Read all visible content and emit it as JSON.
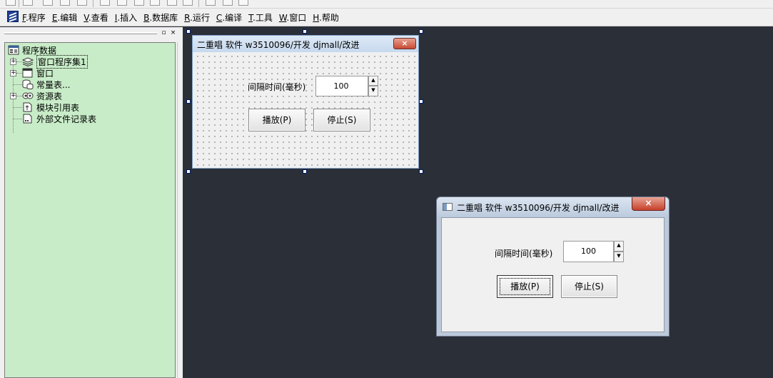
{
  "menu": {
    "items": [
      {
        "key": "F",
        "label": ".程序"
      },
      {
        "key": "E",
        "label": ".编辑"
      },
      {
        "key": "V",
        "label": ".查看"
      },
      {
        "key": "I",
        "label": ".插入"
      },
      {
        "key": "B",
        "label": ".数据库"
      },
      {
        "key": "R",
        "label": ".运行"
      },
      {
        "key": "C",
        "label": ".编译"
      },
      {
        "key": "T",
        "label": ".工具"
      },
      {
        "key": "W",
        "label": ".窗口"
      },
      {
        "key": "H",
        "label": ".帮助"
      }
    ]
  },
  "panel": {
    "pin_glyph": "▫",
    "close_glyph": "×",
    "tree": {
      "root": "程序数据",
      "items": [
        {
          "label": "窗口程序集1",
          "icon": "layers-icon",
          "expandable": true,
          "selected": true
        },
        {
          "label": "窗口",
          "icon": "window-icon",
          "expandable": true
        },
        {
          "label": "常量表...",
          "icon": "cylinder-icon",
          "expandable": false
        },
        {
          "label": "资源表",
          "icon": "resource-icon",
          "expandable": true
        },
        {
          "label": "模块引用表",
          "icon": "document-icon",
          "expandable": false
        },
        {
          "label": "外部文件记录表",
          "icon": "document-icon",
          "expandable": false
        }
      ],
      "expand_glyph": "+"
    }
  },
  "design_form": {
    "title": "二重唱 软件 w3510096/开发 djmall/改进",
    "close_glyph": "×",
    "interval_label": "间隔时间(毫秒)",
    "interval_value": "100",
    "play_button": "播放(P)",
    "stop_button": "停止(S)"
  },
  "run_window": {
    "title": "二重唱 软件 w3510096/开发 djmall/改进",
    "close_glyph": "×",
    "interval_label": "间隔时间(毫秒)",
    "interval_value": "100",
    "play_button": "播放(P)",
    "stop_button": "停止(S)"
  },
  "spin": {
    "up_glyph": "▲",
    "down_glyph": "▼"
  }
}
